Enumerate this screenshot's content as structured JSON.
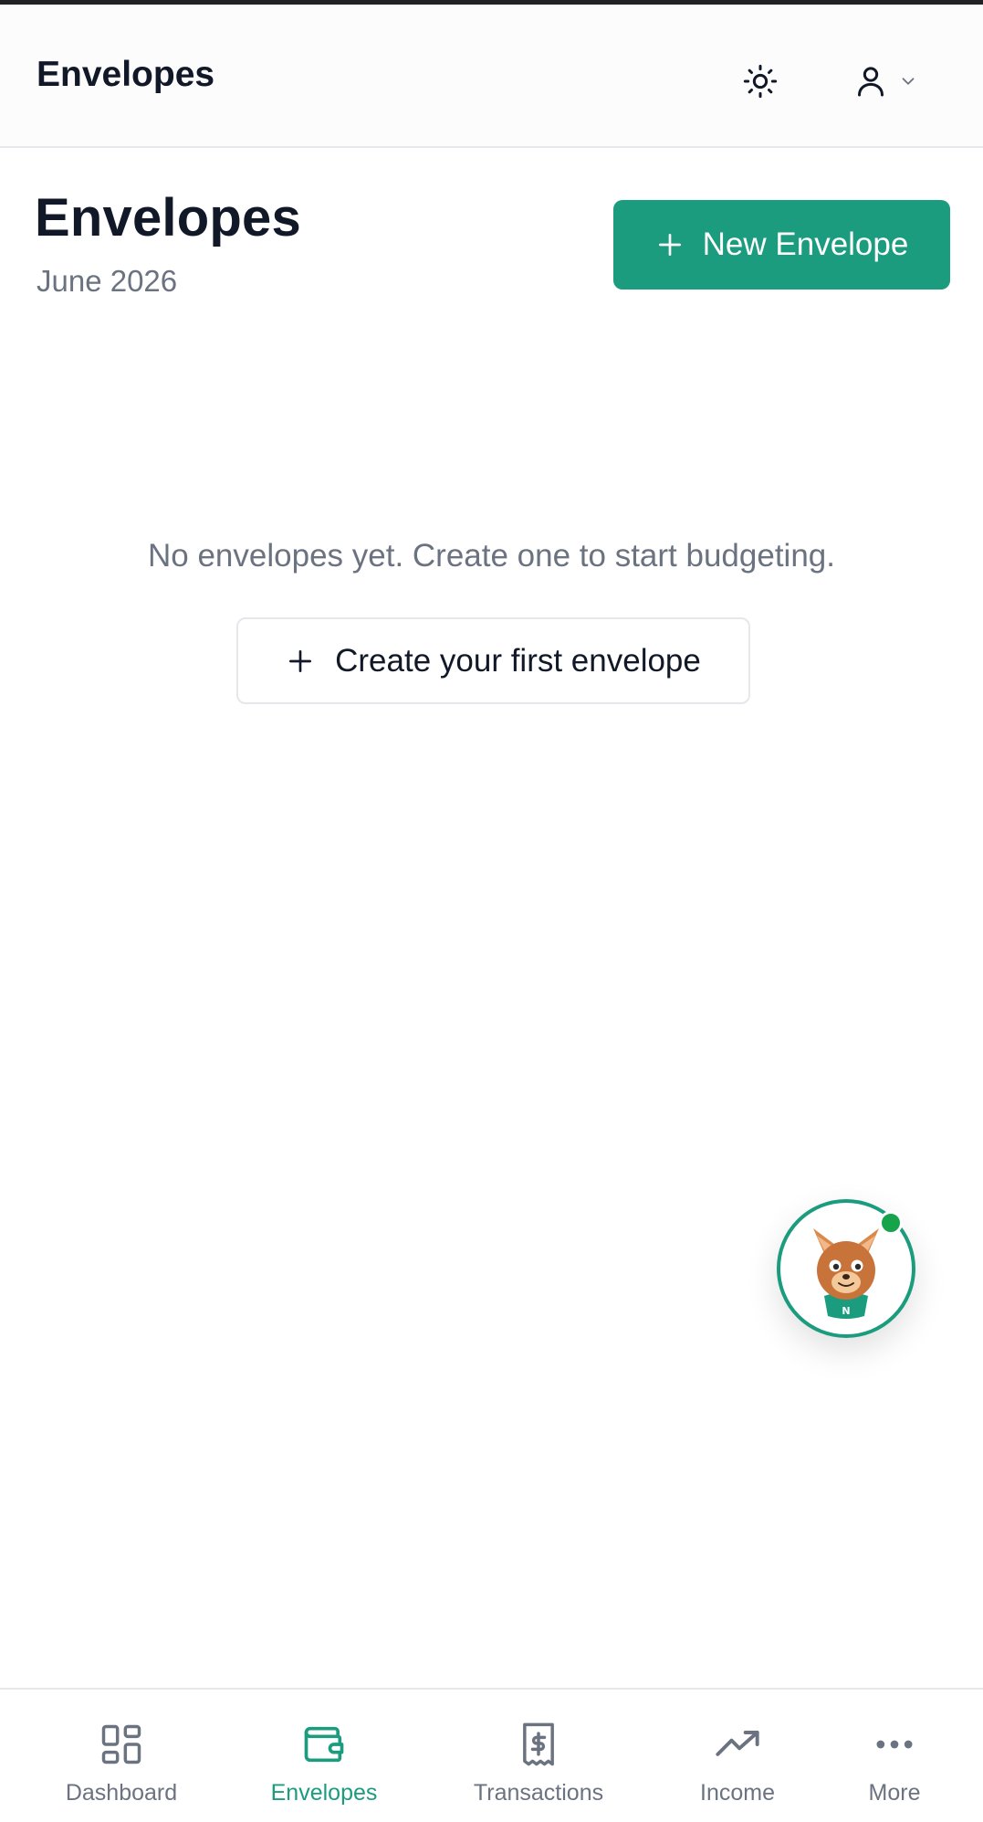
{
  "appbar": {
    "title": "Envelopes",
    "theme_icon": "sun-icon",
    "user_icon": "user-icon",
    "chevron_icon": "chevron-down-icon"
  },
  "page": {
    "title": "Envelopes",
    "subtitle": "June 2026",
    "new_button": {
      "label": "New Envelope",
      "icon": "plus-icon"
    }
  },
  "empty_state": {
    "message": "No envelopes yet. Create one to start budgeting.",
    "cta": {
      "label": "Create your first envelope",
      "icon": "plus-icon"
    }
  },
  "assistant": {
    "icon": "mascot-avatar-icon",
    "badge_letter": "N",
    "status": "online"
  },
  "bottom_nav": {
    "items": [
      {
        "label": "Dashboard",
        "icon": "dashboard-grid-icon",
        "active": false
      },
      {
        "label": "Envelopes",
        "icon": "wallet-icon",
        "active": true
      },
      {
        "label": "Transactions",
        "icon": "receipt-dollar-icon",
        "active": false
      },
      {
        "label": "Income",
        "icon": "trending-up-icon",
        "active": false
      },
      {
        "label": "More",
        "icon": "more-dots-icon",
        "active": false
      }
    ]
  },
  "colors": {
    "accent": "#1b9c7e",
    "text_primary": "#111827",
    "text_muted": "#6b7280",
    "border": "#e5e7eb",
    "status_online": "#16a34a"
  }
}
